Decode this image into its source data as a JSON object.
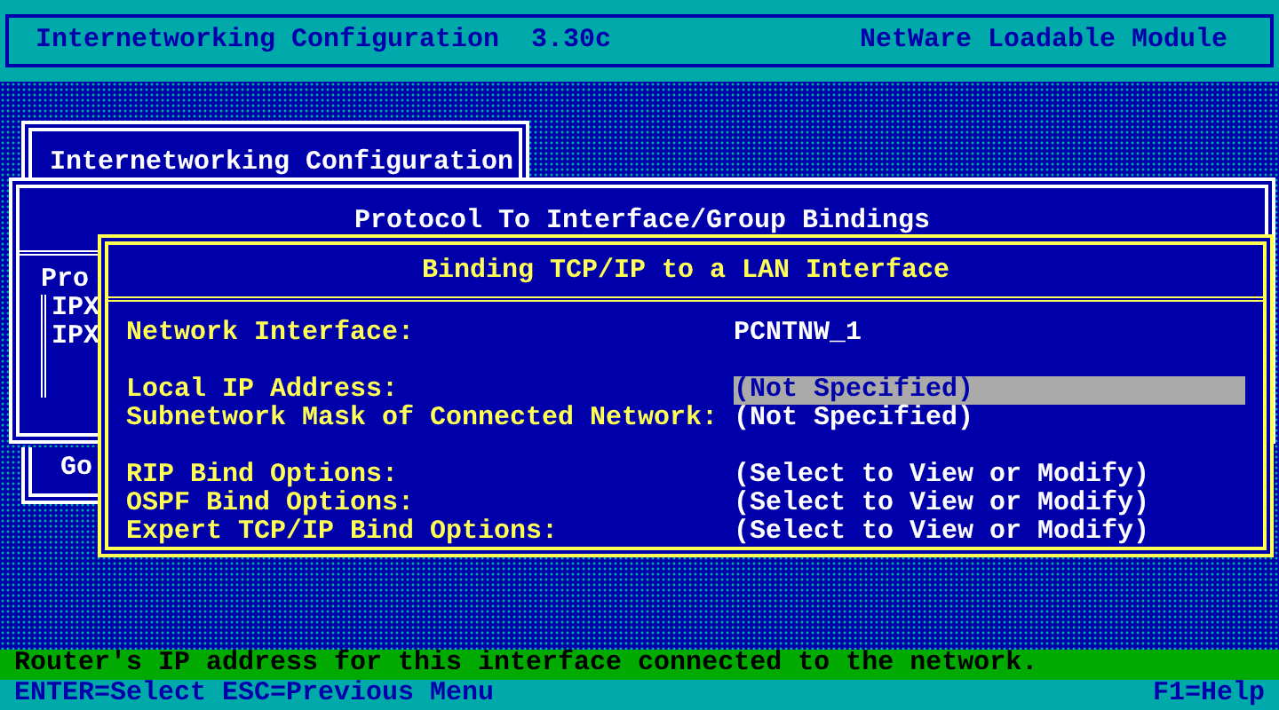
{
  "header": {
    "title": "Internetworking Configuration  3.30c",
    "module": "NetWare Loadable Module"
  },
  "config_window": {
    "title": "Internetworking Configuration"
  },
  "bindings_window": {
    "title": "Protocol To Interface/Group Bindings",
    "column_1": "Pro",
    "rows": [
      "IPX",
      "IPX"
    ]
  },
  "lower_window": {
    "text": "Go"
  },
  "dialog": {
    "title": "Binding TCP/IP to a LAN Interface",
    "field_groups": [
      [
        {
          "label": "Network Interface:",
          "value": "PCNTNW_1",
          "selected": false
        }
      ],
      [
        {
          "label": "Local IP Address:",
          "value": "(Not Specified)",
          "selected": true
        },
        {
          "label": "Subnetwork Mask of Connected Network:",
          "value": "(Not Specified)",
          "selected": false
        }
      ],
      [
        {
          "label": "RIP Bind Options:",
          "value": "(Select to View or Modify)",
          "selected": false
        },
        {
          "label": "OSPF Bind Options:",
          "value": "(Select to View or Modify)",
          "selected": false
        },
        {
          "label": "Expert TCP/IP Bind Options:",
          "value": "(Select to View or Modify)",
          "selected": false
        }
      ]
    ]
  },
  "status_line": "Router's IP address for this interface connected to the network.",
  "key_help": {
    "keys": "ENTER=Select ESC=Previous Menu",
    "help": "F1=Help"
  }
}
